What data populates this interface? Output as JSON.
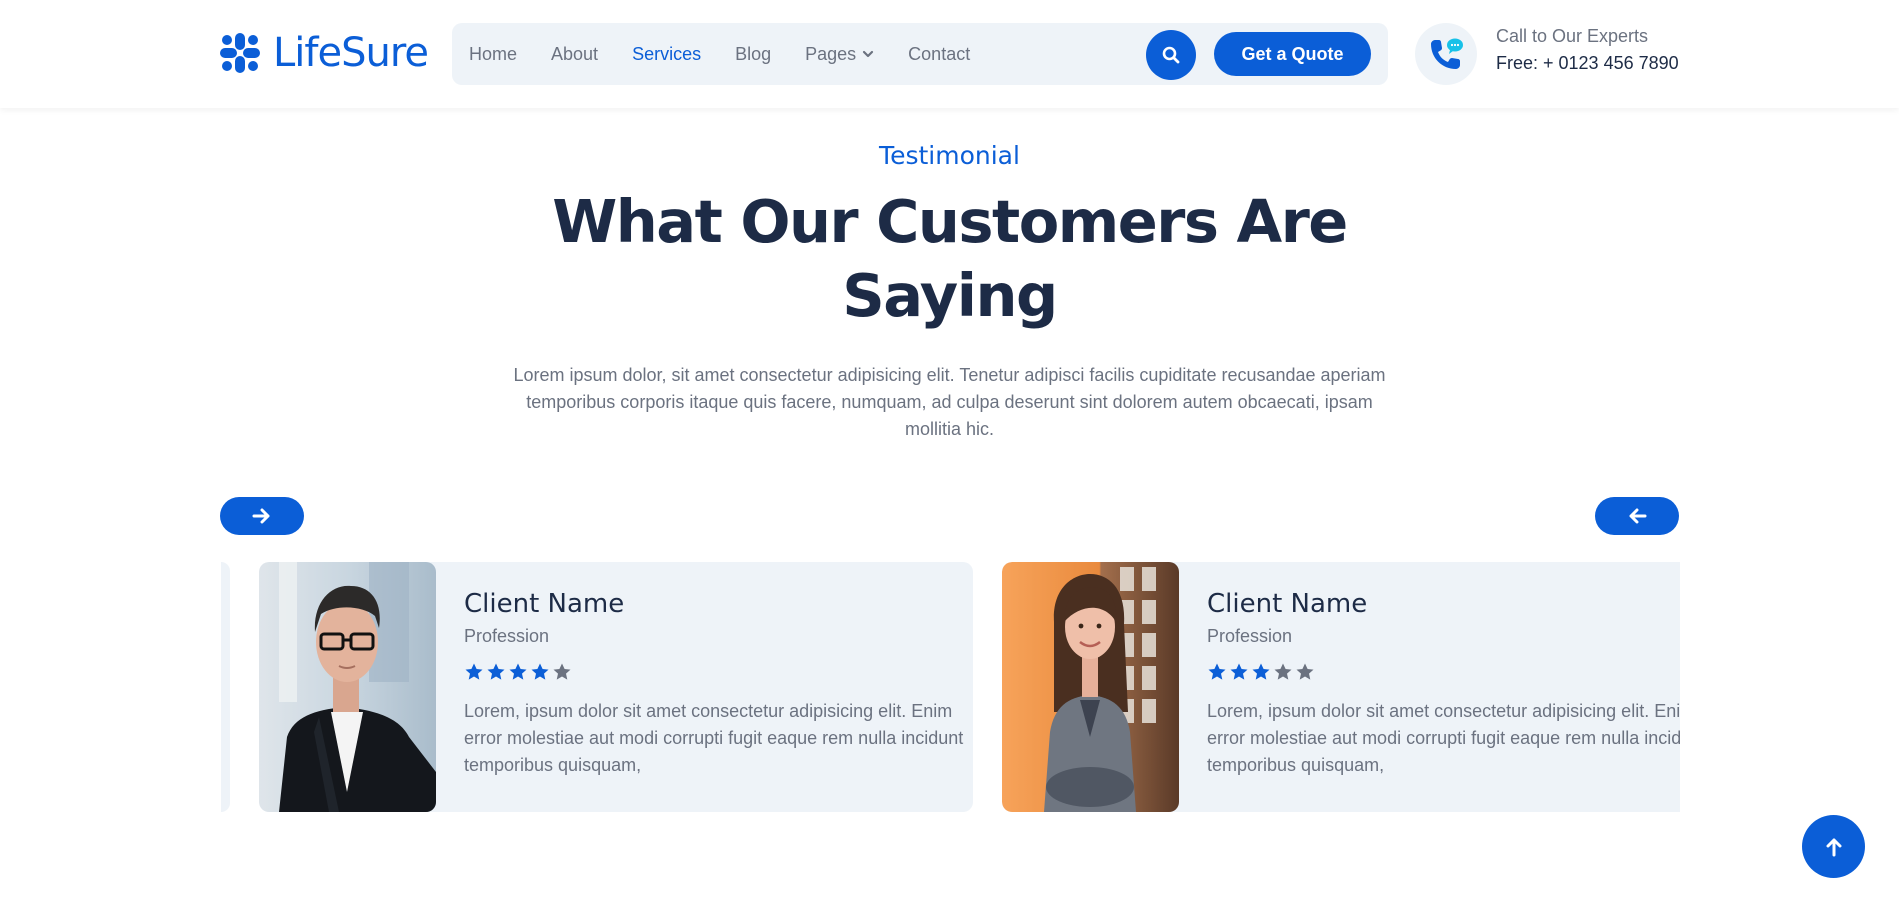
{
  "brand": {
    "name": "LifeSure",
    "accent": "#0b5ed7",
    "dark": "#1d2b46",
    "muted": "#6b7280",
    "panel": "#eef3f8"
  },
  "nav": {
    "items": [
      {
        "label": "Home"
      },
      {
        "label": "About"
      },
      {
        "label": "Services",
        "active": true
      },
      {
        "label": "Blog"
      },
      {
        "label": "Pages",
        "dropdown": true
      },
      {
        "label": "Contact"
      }
    ],
    "search_icon": "search-icon",
    "cta_label": "Get a Quote"
  },
  "contact": {
    "label": "Call to Our Experts",
    "phone": "Free: + 0123 456 7890",
    "icon": "phone-chat-icon"
  },
  "section": {
    "subtitle": "Testimonial",
    "title_line1": "What Our Customers Are",
    "title_line2": "Saying",
    "lead": "Lorem ipsum dolor, sit amet consectetur adipisicing elit. Tenetur adipisci facilis cupiditate recusandae aperiam temporibus corporis itaque quis facere, numquam, ad culpa deserunt sint dolorem autem obcaecati, ipsam mollitia hic."
  },
  "carousel": {
    "next_icon": "arrow-right-icon",
    "prev_icon": "arrow-left-icon"
  },
  "testimonials": [
    {
      "name": "Client Name",
      "profession": "Profession",
      "rating": 4,
      "max_rating": 5,
      "text": "Lorem, ipsum dolor sit amet consectetur adipisicing elit. Enim error molestiae aut modi corrupti fugit eaque rem nulla incidunt temporibus quisquam,"
    },
    {
      "name": "Client Name",
      "profession": "Profession",
      "rating": 3,
      "max_rating": 5,
      "text": "Lorem, ipsum dolor sit amet consectetur adipisicing elit. Enim error molestiae aut modi corrupti fugit eaque rem nulla incidunt temporibus quisquam,"
    }
  ],
  "back_to_top_icon": "arrow-up-icon"
}
